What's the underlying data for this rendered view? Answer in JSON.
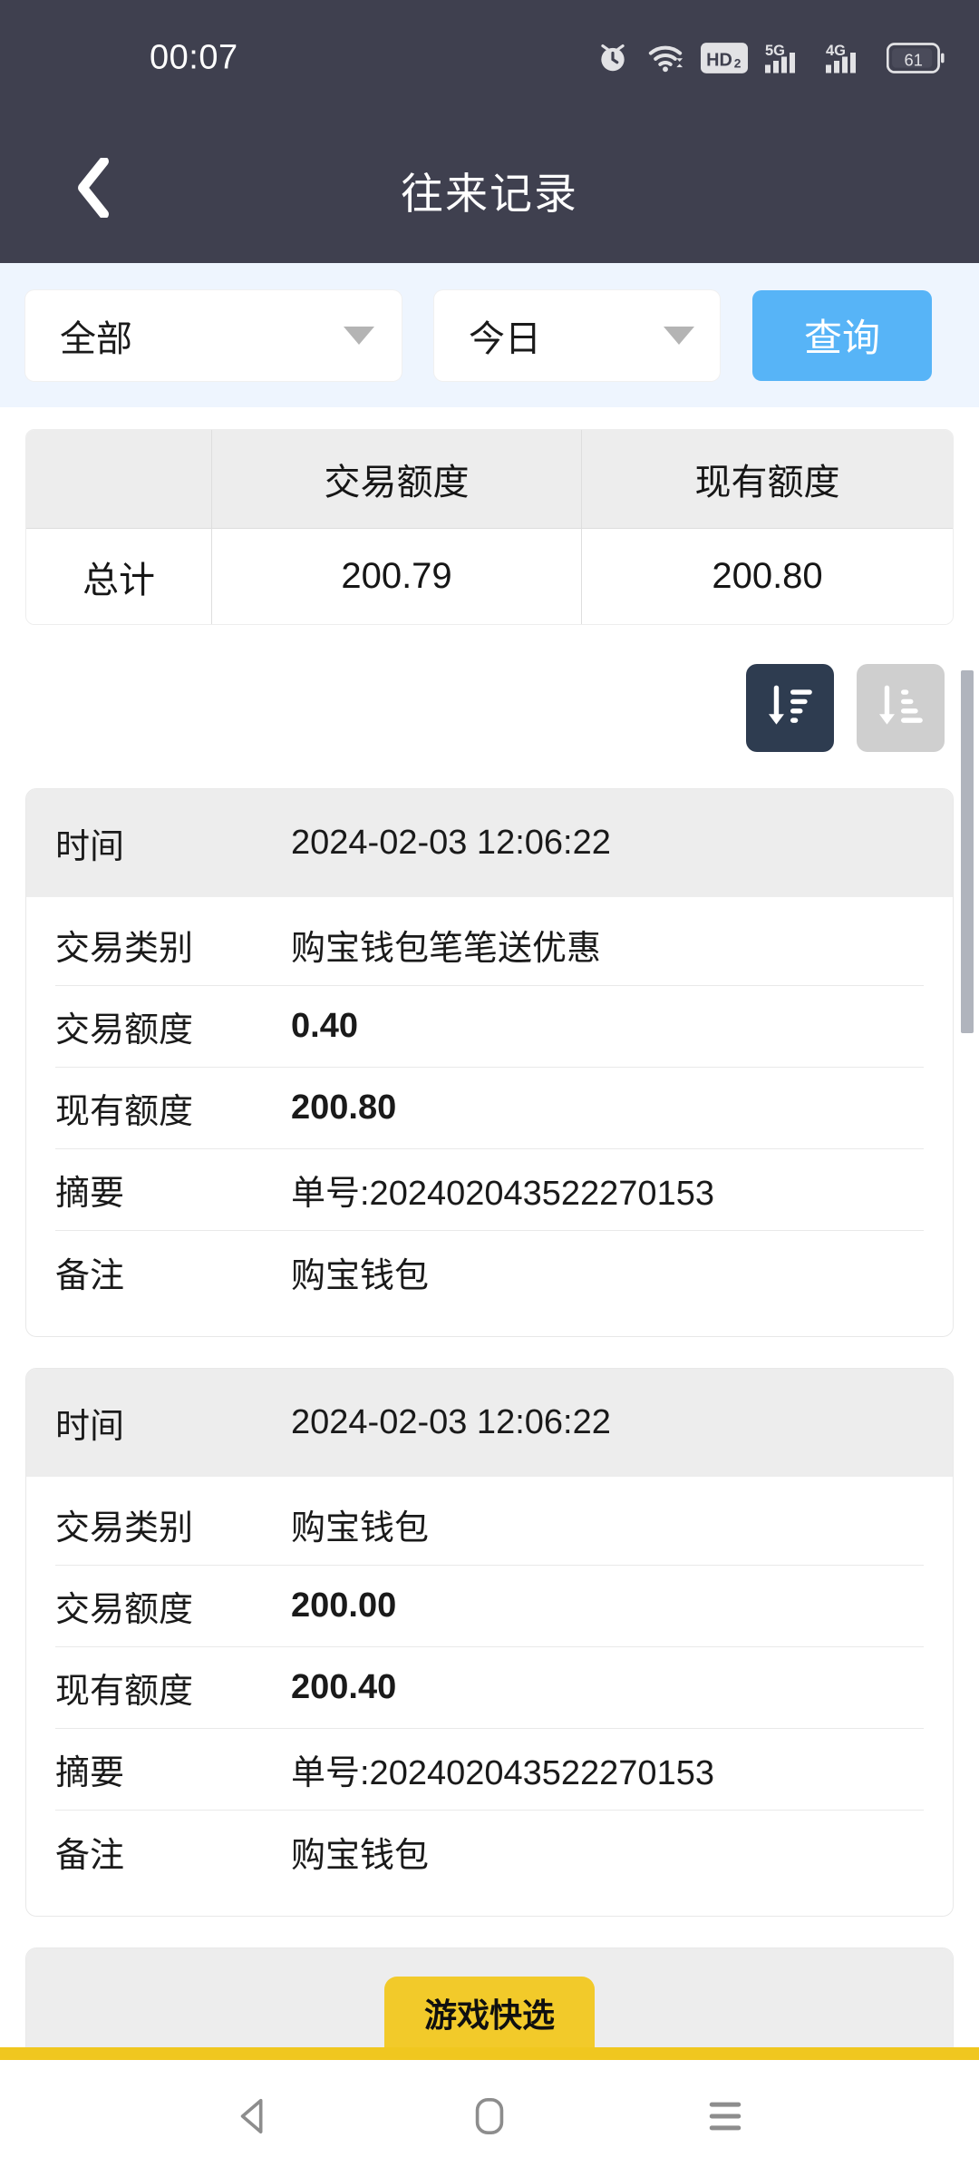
{
  "statusbar": {
    "time": "00:07",
    "battery_level": "61",
    "icons": [
      "alarm-icon",
      "wifi-icon",
      "hd2-icon",
      "signal-5g-icon",
      "signal-4g-icon",
      "battery-icon"
    ],
    "hd_label": "HD",
    "hd_sub": "2",
    "net_5g": "5G",
    "net_4g": "4G",
    "background": "#3f404f"
  },
  "titlebar": {
    "title": "往来记录",
    "back_icon": "chevron-left-icon",
    "background": "#3f404f"
  },
  "filterbar": {
    "background": "#eef5fe",
    "type_select": {
      "value": "全部",
      "caret_icon": "caret-down-icon"
    },
    "date_select": {
      "value": "今日",
      "caret_icon": "caret-down-icon"
    },
    "query_button": {
      "label": "查询",
      "color": "#57b4f7"
    }
  },
  "summary": {
    "headers": [
      "",
      "交易额度",
      "现有额度"
    ],
    "rows": [
      {
        "label": "总计",
        "trade_amount": "200.79",
        "current_amount": "200.80"
      }
    ]
  },
  "sort": {
    "descending": {
      "icon": "sort-descending-icon",
      "active": true,
      "color": "#2e3c50"
    },
    "ascending": {
      "icon": "sort-ascending-icon",
      "active": false,
      "color": "#cfcfcf"
    }
  },
  "labels": {
    "time": "时间",
    "category": "交易类别",
    "trade_amount": "交易额度",
    "current_amount": "现有额度",
    "summary": "摘要",
    "remark": "备注"
  },
  "records": [
    {
      "time": "2024-02-03 12:06:22",
      "category": "购宝钱包笔笔送优惠",
      "trade_amount": "0.40",
      "current_amount": "200.80",
      "summary": "单号:202402043522270153",
      "remark": "购宝钱包"
    },
    {
      "time": "2024-02-03 12:06:22",
      "category": "购宝钱包",
      "trade_amount": "200.00",
      "current_amount": "200.40",
      "summary": "单号:202402043522270153",
      "remark": "购宝钱包"
    }
  ],
  "game_tab": {
    "label": "游戏快选",
    "color": "#f2ca2a"
  },
  "navbar": {
    "back": "nav-back-icon",
    "home": "nav-home-icon",
    "recents": "nav-recents-icon"
  }
}
